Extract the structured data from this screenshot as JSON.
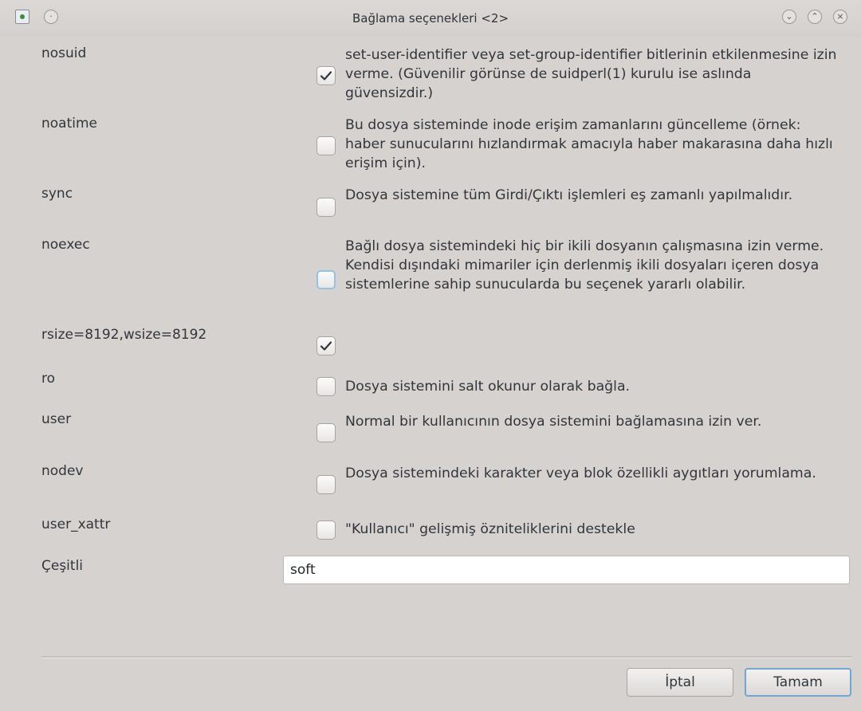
{
  "window": {
    "title": "Bağlama seçenekleri <2>",
    "controls": {
      "minimize": "⌄",
      "maximize": "⌃",
      "close": "×",
      "menu": "·"
    }
  },
  "options": [
    {
      "name": "nosuid",
      "checked": true,
      "description": "set-user-identifier veya set-group-identifier bitlerinin etkilenmesine izin verme. (Güvenilir görünse de suidperl(1) kurulu ise aslında güvensizdir.)"
    },
    {
      "name": "noatime",
      "checked": false,
      "description": "Bu dosya sisteminde inode erişim zamanlarını güncelleme (örnek: haber sunucularını hızlandırmak amacıyla haber makarasına daha hızlı erişim için)."
    },
    {
      "name": "sync",
      "checked": false,
      "description": "Dosya sistemine tüm Girdi/Çıktı işlemleri eş zamanlı yapılmalıdır."
    },
    {
      "name": "noexec",
      "checked": false,
      "focused": true,
      "description": "Bağlı dosya sistemindeki hiç bir ikili dosyanın çalışmasına izin verme. Kendisi dışındaki mimariler için derlenmiş ikili dosyaları içeren dosya sistemlerine sahip sunucularda bu seçenek yararlı olabilir."
    },
    {
      "name": "rsize=8192,wsize=8192",
      "checked": true,
      "description": ""
    },
    {
      "name": "ro",
      "checked": false,
      "description": "Dosya sistemini salt okunur olarak bağla."
    },
    {
      "name": "user",
      "checked": false,
      "description": "Normal bir kullanıcının dosya sistemini bağlamasına izin ver."
    },
    {
      "name": "nodev",
      "checked": false,
      "description": "Dosya sistemindeki karakter veya blok özellikli aygıtları yorumlama."
    },
    {
      "name": "user_xattr",
      "checked": false,
      "description": "\"Kullanıcı\" gelişmiş özniteliklerini destekle"
    }
  ],
  "misc": {
    "label": "Çeşitli",
    "value": "soft"
  },
  "buttons": {
    "cancel": "İptal",
    "ok": "Tamam"
  }
}
